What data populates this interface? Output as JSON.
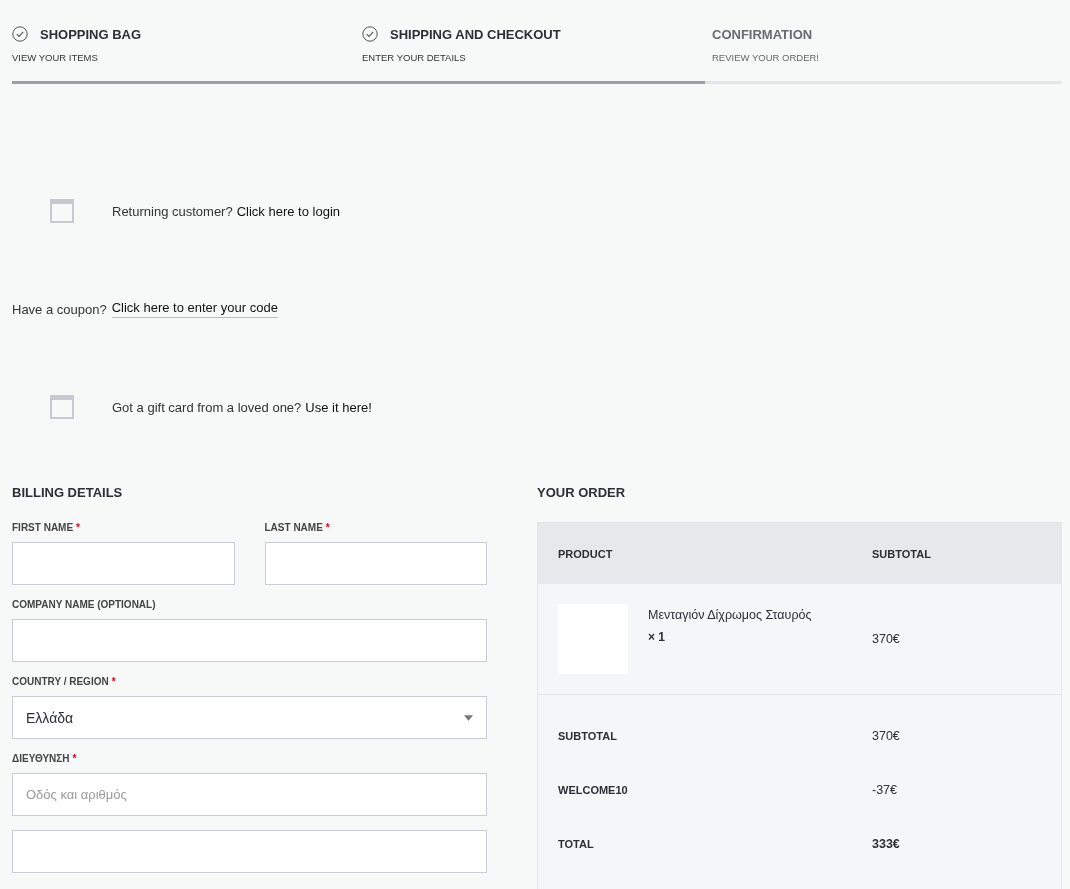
{
  "steps": [
    {
      "title": "SHOPPING BAG",
      "subtitle": "VIEW YOUR ITEMS",
      "completed": true
    },
    {
      "title": "SHIPPING AND CHECKOUT",
      "subtitle": "ENTER YOUR DETAILS",
      "completed": true
    },
    {
      "title": "CONFIRMATION",
      "subtitle": "REVIEW YOUR ORDER!",
      "completed": false
    }
  ],
  "progress": {
    "level": 0.66
  },
  "notices": [
    {
      "kind": "icon",
      "text": "Returning customer?",
      "link": "Click here to login"
    },
    {
      "kind": "underlined",
      "text": "Have a coupon?",
      "link": "Click here to enter your code"
    },
    {
      "kind": "icon",
      "text": "Got a gift card from a loved one?",
      "link": "Use it here!"
    }
  ],
  "billing": {
    "title": "BILLING DETAILS",
    "rows": [
      [
        {
          "kind": "text",
          "label": "FIRST NAME",
          "required_mark": "*"
        },
        {
          "kind": "text",
          "label": "LAST NAME",
          "required_mark": "*"
        }
      ],
      [
        {
          "kind": "text",
          "label": "COMPANY NAME (OPTIONAL)"
        }
      ],
      [
        {
          "kind": "select",
          "label": "COUNTRY / REGION",
          "required_mark": "*",
          "value": "Ελλάδα"
        }
      ],
      [
        {
          "kind": "text",
          "label": "ΔΙΕΥΘΥΝΣΗ",
          "required_mark": "*",
          "placeholder": "Οδός και αριθμός"
        }
      ],
      [
        {
          "kind": "text"
        }
      ]
    ]
  },
  "order": {
    "title": "YOUR ORDER",
    "columns": [
      "PRODUCT",
      "SUBTOTAL"
    ],
    "items": [
      {
        "name": "Μενταγιόν Δίχρωμος Σταυρός",
        "quantity": "× 1",
        "subtotal": "370€"
      }
    ],
    "totals": [
      {
        "label": "SUBTOTAL",
        "value": "370€",
        "bold": false
      },
      {
        "label": "WELCOME10",
        "value": "-37€",
        "bold": false
      },
      {
        "label": "TOTAL",
        "value": "333€",
        "bold": true
      }
    ]
  }
}
